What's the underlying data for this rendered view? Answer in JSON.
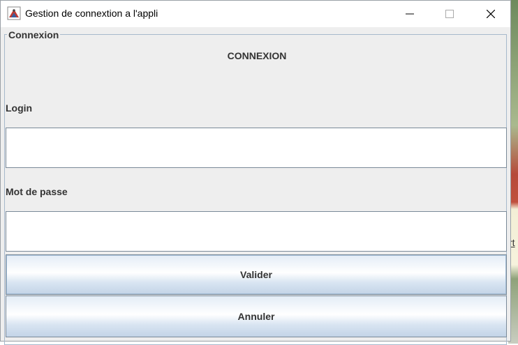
{
  "window": {
    "title": "Gestion de connextion a l'appli",
    "icon": "java-app-icon",
    "controls": [
      "minimize-icon",
      "maximize-icon",
      "close-icon"
    ]
  },
  "form": {
    "group_label": "Connexion",
    "heading": "CONNEXION",
    "login_label": "Login",
    "login_value": "",
    "password_label": "Mot de passe",
    "password_value": "",
    "submit_label": "Valider",
    "cancel_label": "Annuler"
  },
  "background": {
    "peek_text": "rt"
  },
  "colors": {
    "panel": "#eeeeee",
    "border": "#a6b8cc",
    "text": "#333333"
  }
}
